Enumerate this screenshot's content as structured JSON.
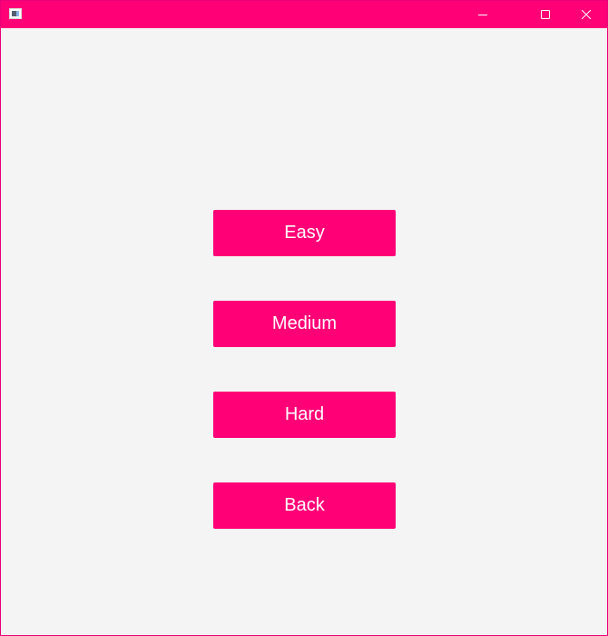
{
  "window": {
    "title": "",
    "accent_color": "#ff0077",
    "background_color": "#f4f4f4",
    "controls": {
      "minimize_icon": "minimize-icon",
      "maximize_icon": "maximize-icon",
      "close_icon": "close-icon"
    }
  },
  "menu": {
    "buttons": [
      {
        "label": "Easy"
      },
      {
        "label": "Medium"
      },
      {
        "label": "Hard"
      },
      {
        "label": "Back"
      }
    ]
  }
}
